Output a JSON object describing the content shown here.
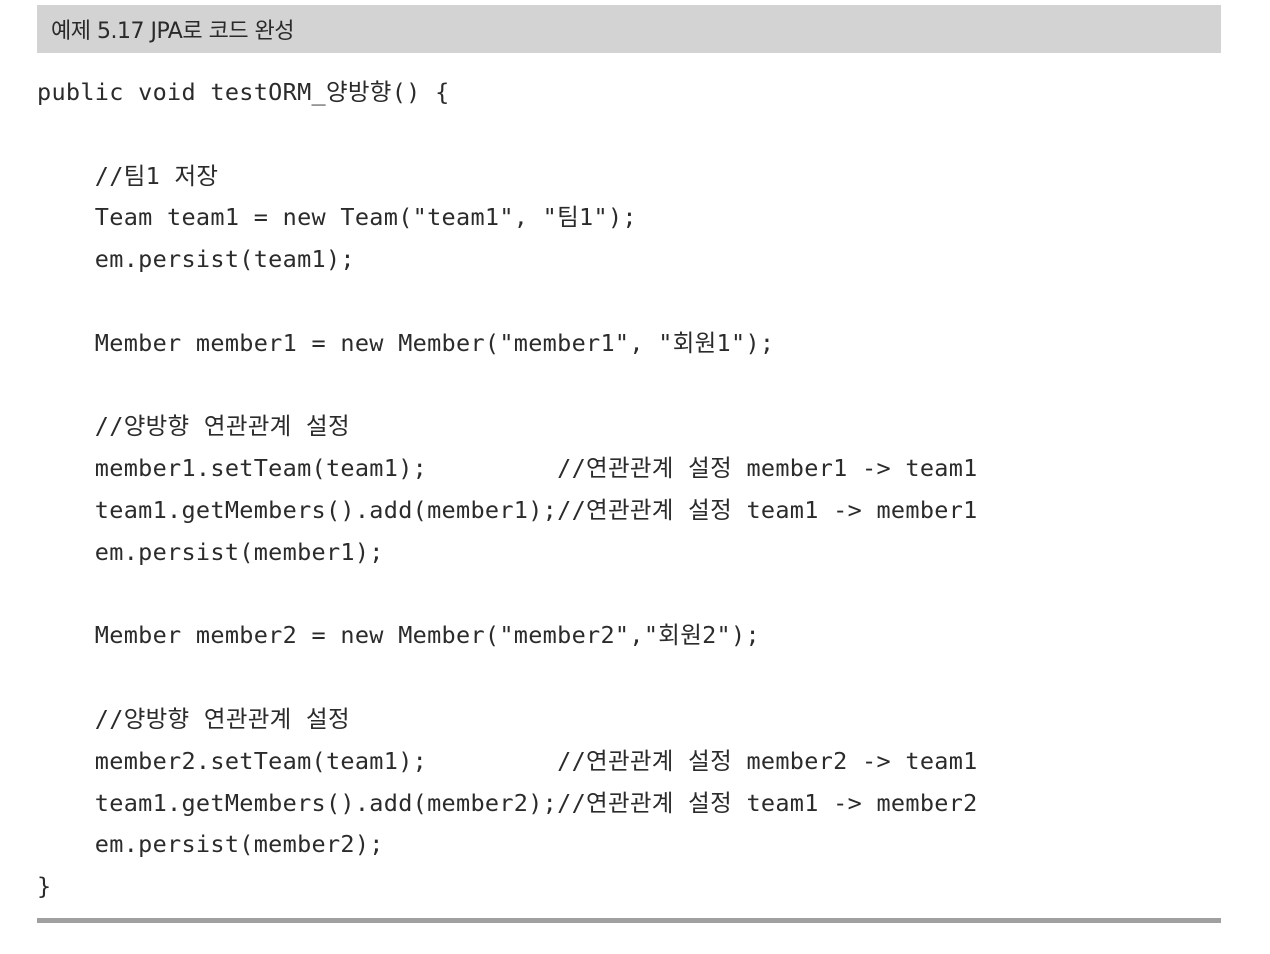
{
  "listing": {
    "title": "예제 5.17 JPA로 코드 완성",
    "code_lines": [
      "public void testORM_양방향() {",
      "",
      "    //팀1 저장",
      "    Team team1 = new Team(\"team1\", \"팀1\");",
      "    em.persist(team1);",
      "",
      "    Member member1 = new Member(\"member1\", \"회원1\");",
      "",
      "    //양방향 연관관계 설정",
      "    member1.setTeam(team1);         //연관관계 설정 member1 -> team1",
      "    team1.getMembers().add(member1);//연관관계 설정 team1 -> member1",
      "    em.persist(member1);",
      "",
      "    Member member2 = new Member(\"member2\",\"회원2\");",
      "",
      "    //양방향 연관관계 설정",
      "    member2.setTeam(team1);         //연관관계 설정 member2 -> team1",
      "    team1.getMembers().add(member2);//연관관계 설정 team1 -> member2",
      "    em.persist(member2);",
      "}"
    ]
  },
  "colors": {
    "header_background": "#d3d3d3",
    "text": "#2b2b2b",
    "rule": "#a0a0a0"
  }
}
